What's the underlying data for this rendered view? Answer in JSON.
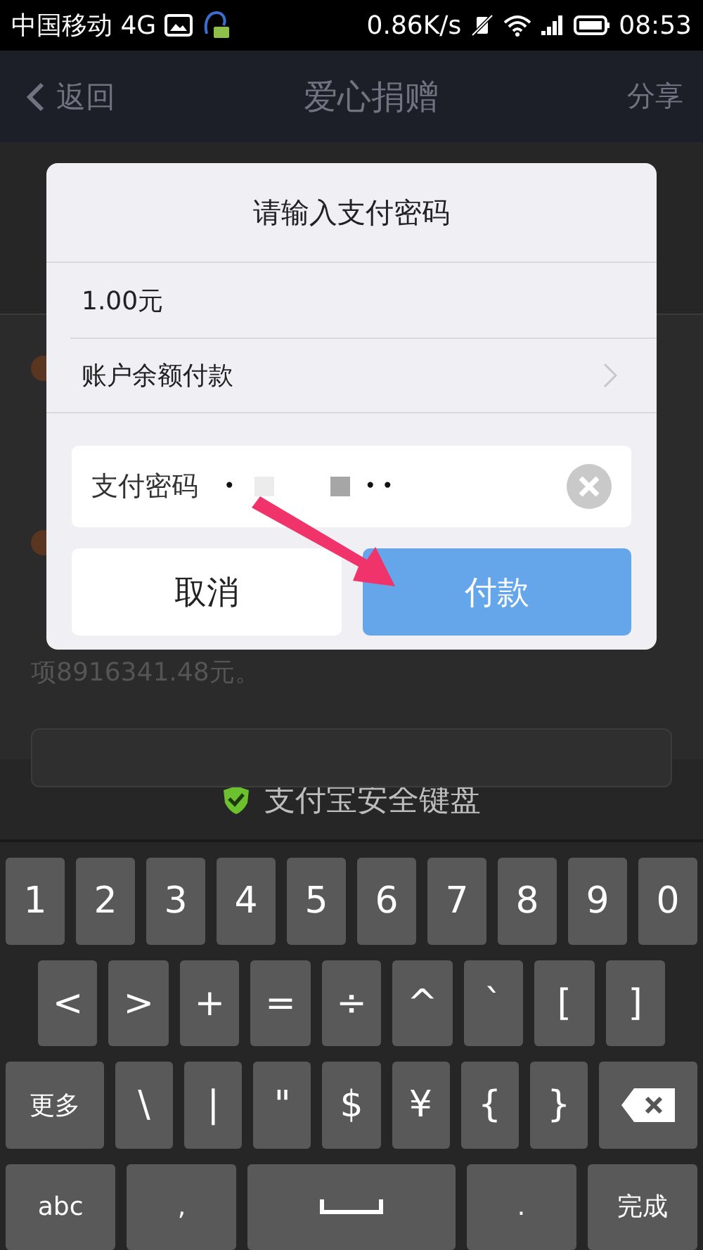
{
  "status_bar": {
    "carrier": "中国移动 4G",
    "speed": "0.86K/s",
    "time": "08:53"
  },
  "nav_bar": {
    "back": "返回",
    "title": "爱心捐赠",
    "action": "分享"
  },
  "background_page": {
    "text": "项8916341.48元。"
  },
  "dialog": {
    "title": "请输入支付密码",
    "amount": "1.00元",
    "payment_method": "账户余额付款",
    "password_field": {
      "label": "支付密码",
      "dots_before": "•",
      "dots_after": "••"
    },
    "buttons": [
      {
        "label": "取消",
        "kind": "secondary"
      },
      {
        "label": "付款",
        "kind": "primary"
      }
    ]
  },
  "keyboard": {
    "title": "支付宝安全键盘",
    "rows": [
      [
        {
          "label": "1"
        },
        {
          "label": "2"
        },
        {
          "label": "3"
        },
        {
          "label": "4"
        },
        {
          "label": "5"
        },
        {
          "label": "6"
        },
        {
          "label": "7"
        },
        {
          "label": "8"
        },
        {
          "label": "9"
        },
        {
          "label": "0"
        }
      ],
      [
        {
          "label": "<"
        },
        {
          "label": ">"
        },
        {
          "label": "+"
        },
        {
          "label": "="
        },
        {
          "label": "÷"
        },
        {
          "label": "^"
        },
        {
          "label": "`"
        },
        {
          "label": "["
        },
        {
          "label": "]"
        }
      ],
      [
        {
          "label": "更多",
          "kind": "wide"
        },
        {
          "label": "\\"
        },
        {
          "label": "|"
        },
        {
          "label": "\""
        },
        {
          "label": "$"
        },
        {
          "label": "¥"
        },
        {
          "label": "{"
        },
        {
          "label": "}"
        },
        {
          "kind": "backspace"
        }
      ],
      [
        {
          "label": "abc",
          "kind": "wide"
        },
        {
          "label": ",",
          "kind": "wide"
        },
        {
          "kind": "space"
        },
        {
          "label": ".",
          "kind": "wide"
        },
        {
          "label": "完成",
          "kind": "wide"
        }
      ]
    ]
  }
}
